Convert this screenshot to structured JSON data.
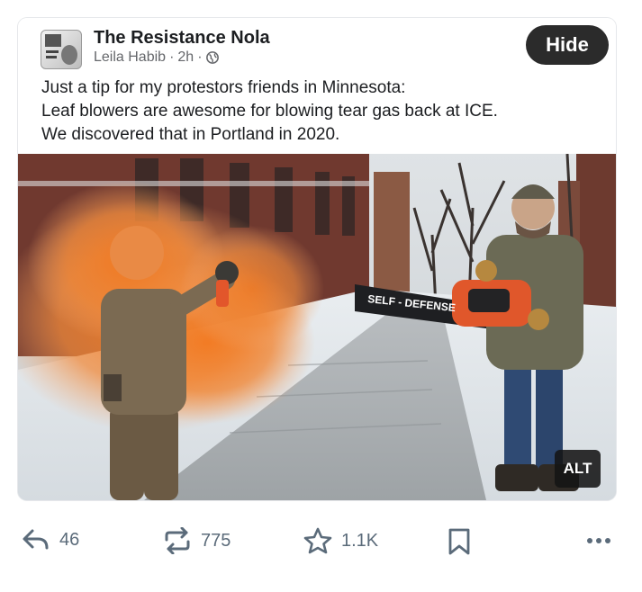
{
  "post": {
    "page_name": "The Resistance Nola",
    "author": "Leila Habib",
    "separator": "·",
    "time": "2h",
    "visibility_icon": "globe-icon",
    "hide_label": "Hide",
    "text_lines": [
      "Just a tip for my protestors friends in Minnesota:",
      "Leaf blowers are awesome for blowing tear gas back at ICE.",
      "We discovered that in Portland in 2020."
    ]
  },
  "image": {
    "blower_label": "SELF - DEFENSE",
    "alt_label": "ALT"
  },
  "actions": {
    "reply_icon": "reply-icon",
    "reply_count": "46",
    "repost_icon": "repost-icon",
    "repost_count": "775",
    "like_icon": "star-icon",
    "like_count": "1.1K",
    "bookmark_icon": "bookmark-icon",
    "more_icon": "more-icon"
  },
  "colors": {
    "hide_button_bg": "#2b2b2b",
    "action_icon": "#5b6b7a",
    "smoke_orange": "#f07a2a"
  }
}
